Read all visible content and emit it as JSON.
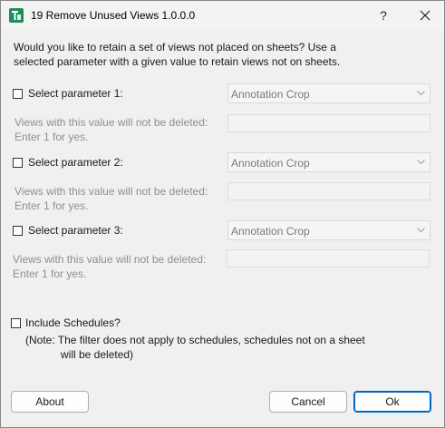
{
  "window": {
    "title": "19 Remove Unused Views 1.0.0.0",
    "help_symbol": "?",
    "close_icon": "close-icon"
  },
  "intro_line1": "Would you like to retain a set of views not placed on sheets? Use a",
  "intro_line2": "selected parameter with a given value to retain views not on sheets.",
  "params": [
    {
      "label": "Select parameter 1:",
      "checked": false,
      "selected": "Annotation Crop",
      "hint_line1": "Views with this value will not be deleted:",
      "hint_line2": "Enter 1 for yes.",
      "value": ""
    },
    {
      "label": "Select parameter 2:",
      "checked": false,
      "selected": "Annotation Crop",
      "hint_line1": "Views with this value will not be deleted:",
      "hint_line2": "Enter 1 for yes.",
      "value": ""
    },
    {
      "label": "Select parameter 3:",
      "checked": false,
      "selected": "Annotation Crop",
      "hint_line1": "Views with this value will not be deleted:",
      "hint_line2": "Enter 1 for yes.",
      "value": ""
    }
  ],
  "schedules": {
    "label": "Include  Schedules?",
    "checked": false,
    "note_line1": "(Note: The filter does not apply to schedules, schedules not on a sheet",
    "note_line2": "will be deleted)"
  },
  "buttons": {
    "about": "About",
    "cancel": "Cancel",
    "ok": "Ok"
  },
  "colors": {
    "accent": "#0067c0",
    "icon_green": "#1e8e5a"
  }
}
